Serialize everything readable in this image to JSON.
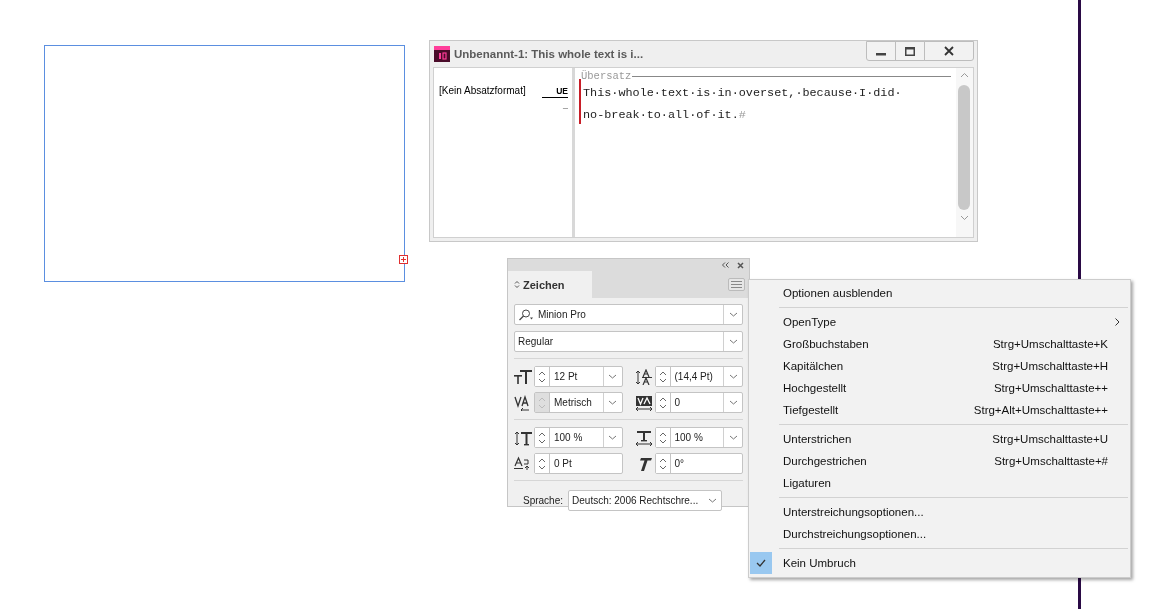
{
  "document_frame": {
    "overset": true
  },
  "story_editor": {
    "title": "Unbenannt-1: This whole text is i...",
    "paragraph_style": "[Kein Absatzformat]",
    "depth_marks": [
      "UE",
      "_"
    ],
    "overset_label": "Übersatz",
    "lines": [
      "This·whole·text·is·in·overset,·because·I·did·",
      "no-break·to·all·of·it."
    ],
    "end_mark": "#"
  },
  "character_panel": {
    "tab": "Zeichen",
    "font_family": "Minion Pro",
    "font_style": "Regular",
    "groups": [
      [
        {
          "kind": "size",
          "value": "12 Pt",
          "dropdown": true,
          "spinner_disabled": false
        },
        {
          "kind": "leading",
          "value": "(14,4 Pt)",
          "dropdown": true,
          "spinner_disabled": false
        },
        {
          "kind": "kerning",
          "value": "Metrisch",
          "dropdown": true,
          "spinner_disabled": true
        },
        {
          "kind": "tracking",
          "value": "0",
          "dropdown": true,
          "spinner_disabled": false
        }
      ],
      [
        {
          "kind": "vscale",
          "value": "100 %",
          "dropdown": true,
          "spinner_disabled": false
        },
        {
          "kind": "hscale",
          "value": "100 %",
          "dropdown": true,
          "spinner_disabled": false
        },
        {
          "kind": "baseline",
          "value": "0 Pt",
          "dropdown": false,
          "spinner_disabled": false
        },
        {
          "kind": "skew",
          "value": "0°",
          "dropdown": false,
          "spinner_disabled": false
        }
      ]
    ],
    "language_label": "Sprache:",
    "language": "Deutsch: 2006 Rechtschre..."
  },
  "context_menu": {
    "groups": [
      [
        {
          "label": "Optionen ausblenden",
          "submenu": false,
          "checked": false
        }
      ],
      [
        {
          "label": "OpenType",
          "submenu": true,
          "checked": false
        },
        {
          "label": "Großbuchstaben",
          "shortcut": "Strg+Umschalttaste+K",
          "submenu": false,
          "checked": false
        },
        {
          "label": "Kapitälchen",
          "shortcut": "Strg+Umschalttaste+H",
          "submenu": false,
          "checked": false
        },
        {
          "label": "Hochgestellt",
          "shortcut": "Strg+Umschalttaste++",
          "submenu": false,
          "checked": false
        },
        {
          "label": "Tiefgestellt",
          "shortcut": "Strg+Alt+Umschalttaste++",
          "submenu": false,
          "checked": false
        }
      ],
      [
        {
          "label": "Unterstrichen",
          "shortcut": "Strg+Umschalttaste+U",
          "submenu": false,
          "checked": false
        },
        {
          "label": "Durchgestrichen",
          "shortcut": "Strg+Umschalttaste+#",
          "submenu": false,
          "checked": false
        },
        {
          "label": "Ligaturen",
          "submenu": false,
          "checked": false
        }
      ],
      [
        {
          "label": "Unterstreichungsoptionen...",
          "submenu": false,
          "checked": false
        },
        {
          "label": "Durchstreichungsoptionen...",
          "submenu": false,
          "checked": false
        }
      ],
      [
        {
          "label": "Kein Umbruch",
          "submenu": false,
          "checked": true
        }
      ]
    ]
  }
}
